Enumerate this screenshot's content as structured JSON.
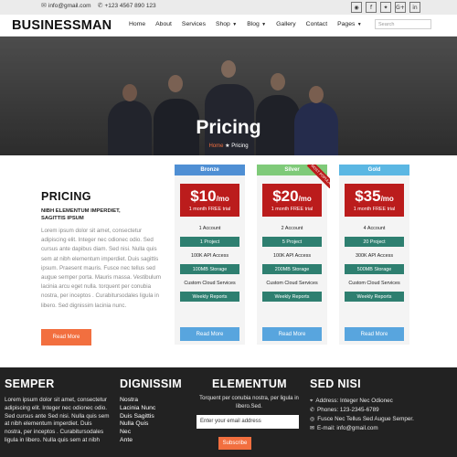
{
  "topbar": {
    "email": "info@gmail.com",
    "phone": "+123 4567 890 123",
    "social": [
      "rss-icon",
      "facebook-icon",
      "twitter-icon",
      "google-plus-icon",
      "linkedin-icon"
    ]
  },
  "header": {
    "logo": "BUSINESSMAN",
    "nav": [
      {
        "label": "Home",
        "caret": false
      },
      {
        "label": "About",
        "caret": false
      },
      {
        "label": "Services",
        "caret": false
      },
      {
        "label": "Shop",
        "caret": true
      },
      {
        "label": "Blog",
        "caret": true
      },
      {
        "label": "Gallery",
        "caret": false
      },
      {
        "label": "Contact",
        "caret": false
      },
      {
        "label": "Pages",
        "caret": true
      }
    ],
    "search_placeholder": "Search"
  },
  "hero": {
    "title": "Pricing",
    "breadcrumb_home": "Home",
    "breadcrumb_current": "Pricing"
  },
  "intro": {
    "title": "PRICING",
    "subtitle_line1": "NIBH ELEMENTUM IMPERDIET,",
    "subtitle_line2": "SAGITTIS IPSUM",
    "body": "Lorem ipsum dolor sit amet, consectetur adipiscing elit. Integer nec odionec odio. Sed cursus ante dapibus diam. Sed nisi. Nulla quis sem at nibh elementum imperdiet. Duis sagittis ipsum. Praesent mauris. Fusce nec tellus sed augue semper porta. Mauris massa. Vestibulum lacinia arcu eget nulla. torquent per conubia nostra, per inceptos . Curabitursodales ligula in libero. Sed dignissim lacinia nunc.",
    "button": "Read More"
  },
  "plans": [
    {
      "name": "Bronze",
      "color": "#4f8fd4",
      "amount": "$10",
      "period": "/mo",
      "trial": "1 month FREE trial",
      "features": [
        "1 Account",
        "1 Project",
        "100K API Access",
        "100MB Storage",
        "Custom Cloud Services",
        "Weekly Reports"
      ],
      "button": "Read More",
      "ribbon": ""
    },
    {
      "name": "Silver",
      "color": "#7fca79",
      "amount": "$20",
      "period": "/mo",
      "trial": "1 month FREE trial",
      "features": [
        "2 Account",
        "5 Project",
        "100K API Access",
        "200MB Storage",
        "Custom Cloud Services",
        "Weekly Reports"
      ],
      "button": "Read More",
      "ribbon": "MOST POPULAR"
    },
    {
      "name": "Gold",
      "color": "#5bb7e3",
      "amount": "$35",
      "period": "/mo",
      "trial": "1 month FREE trial",
      "features": [
        "4 Account",
        "20 Project",
        "300K API Access",
        "500MB Storage",
        "Custom Cloud Services",
        "Weekly Reports"
      ],
      "button": "Read More",
      "ribbon": ""
    }
  ],
  "footer": {
    "col1": {
      "title": "SEMPER",
      "text": "Lorem ipsum dolor sit amet, consectetur adipiscing elit. Integer nec odionec odio. Sed cursus ante Sed nisi. Nulla quis sem at nibh elementum imperdiet. Duis nostra, per inceptos . Curabitursodales ligula in libero. Nulla quis sem at nibh"
    },
    "col2": {
      "title": "DIGNISSIM",
      "links": [
        "Nostra",
        "Lacinia Nunc",
        "Duis Sagittis",
        "Nulla Quis",
        "Nec",
        "Ante"
      ]
    },
    "col3": {
      "title": "ELEMENTUM",
      "text": "Torquent per conubia nostra, per ligula in libero.Sed.",
      "email_placeholder": "Enter your email address",
      "button": "Subscribe"
    },
    "col4": {
      "title": "SED NISI",
      "address": "Address: Integer Nec Odionec",
      "phones": "Phones: 123-2345-6789",
      "fusce": "Fusce Nec Tellus Sed Augue Semper.",
      "email": "E-mail: info@gmail.com"
    }
  }
}
